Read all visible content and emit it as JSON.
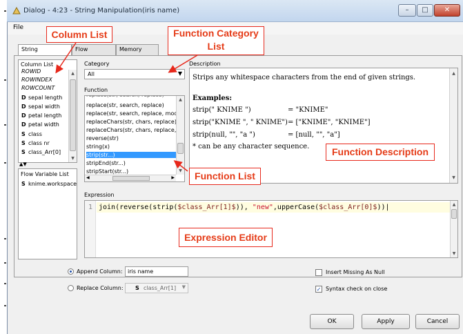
{
  "window": {
    "title": "Dialog - 4:23 - String Manipulation(iris name)",
    "menu": [
      "File"
    ],
    "controls": [
      "minimize-icon",
      "maximize-icon",
      "close-icon"
    ]
  },
  "tabs": [
    "String Manipulation",
    "Flow Variables",
    "Memory Policy"
  ],
  "column_list": {
    "header": "Column List",
    "items": [
      {
        "mark": "",
        "label": "ROWID",
        "italic": true
      },
      {
        "mark": "",
        "label": "ROWINDEX",
        "italic": true
      },
      {
        "mark": "",
        "label": "ROWCOUNT",
        "italic": true
      },
      {
        "mark": "D",
        "label": "sepal length"
      },
      {
        "mark": "D",
        "label": "sepal width"
      },
      {
        "mark": "D",
        "label": "petal length"
      },
      {
        "mark": "D",
        "label": "petal width"
      },
      {
        "mark": "S",
        "label": "class"
      },
      {
        "mark": "S",
        "label": "class nr"
      },
      {
        "mark": "S",
        "label": "class_Arr[0]"
      }
    ]
  },
  "flow_variable_list": {
    "header": "Flow Variable List",
    "items": [
      {
        "mark": "S",
        "label": "knime.workspace"
      }
    ]
  },
  "category": {
    "label": "Category",
    "value": "All"
  },
  "function": {
    "label": "Function",
    "items": [
      "replace(str, search, replace)",
      "replace(str, search, replace, modif",
      "replaceChars(str, chars, replace)",
      "replaceChars(str, chars, replace, r",
      "reverse(str)",
      "string(x)",
      "strip(str...)",
      "stripEnd(str...)",
      "stripStart(str...)"
    ],
    "selected_index": 6
  },
  "description": {
    "label": "Description",
    "summary": "Strips any whitespace characters from the end of given strings.",
    "examples_heading": "Examples:",
    "examples": [
      {
        "call": "strip(\"  KNIME  \")",
        "result": "= \"KNIME\""
      },
      {
        "call": "strip(\"KNIME \", \"  KNIME\")",
        "result": "= [\"KNIME\", \"KNIME\"]"
      },
      {
        "call": "strip(null, \"\", \"a  \")",
        "result": "= [null, \"\", \"a\"]"
      }
    ],
    "note": "* can be any character sequence."
  },
  "expression": {
    "label": "Expression",
    "line_number": "1",
    "tokens": [
      {
        "t": "join(",
        "c": "#000000"
      },
      {
        "t": "reverse(strip(",
        "c": "#000000"
      },
      {
        "t": "$class_Arr[1]$",
        "c": "#7a1a1a"
      },
      {
        "t": ")), ",
        "c": "#000000"
      },
      {
        "t": "\"new\"",
        "c": "#c8102e"
      },
      {
        "t": ",upperCase(",
        "c": "#000000"
      },
      {
        "t": "$class_Arr[0]$",
        "c": "#7a1a1a"
      },
      {
        "t": "))",
        "c": "#000000"
      }
    ]
  },
  "options": {
    "append_label": "Append Column:",
    "append_value": "iris name",
    "replace_label": "Replace Column:",
    "replace_value": "class_Arr[1]",
    "replace_type": "S",
    "insert_missing": "Insert Missing As Null",
    "syntax_check": "Syntax check on close"
  },
  "buttons": {
    "ok": "OK",
    "apply": "Apply",
    "cancel": "Cancel"
  },
  "annotations": {
    "column_list": "Column List",
    "function_category": "Function Category\nList",
    "function_description": "Function Description",
    "function_list": "Function List",
    "expression_editor": "Expression Editor"
  },
  "colors": {
    "annotation": "#e53b17",
    "selection": "#3399ff",
    "editor_line": "#fffde0"
  }
}
